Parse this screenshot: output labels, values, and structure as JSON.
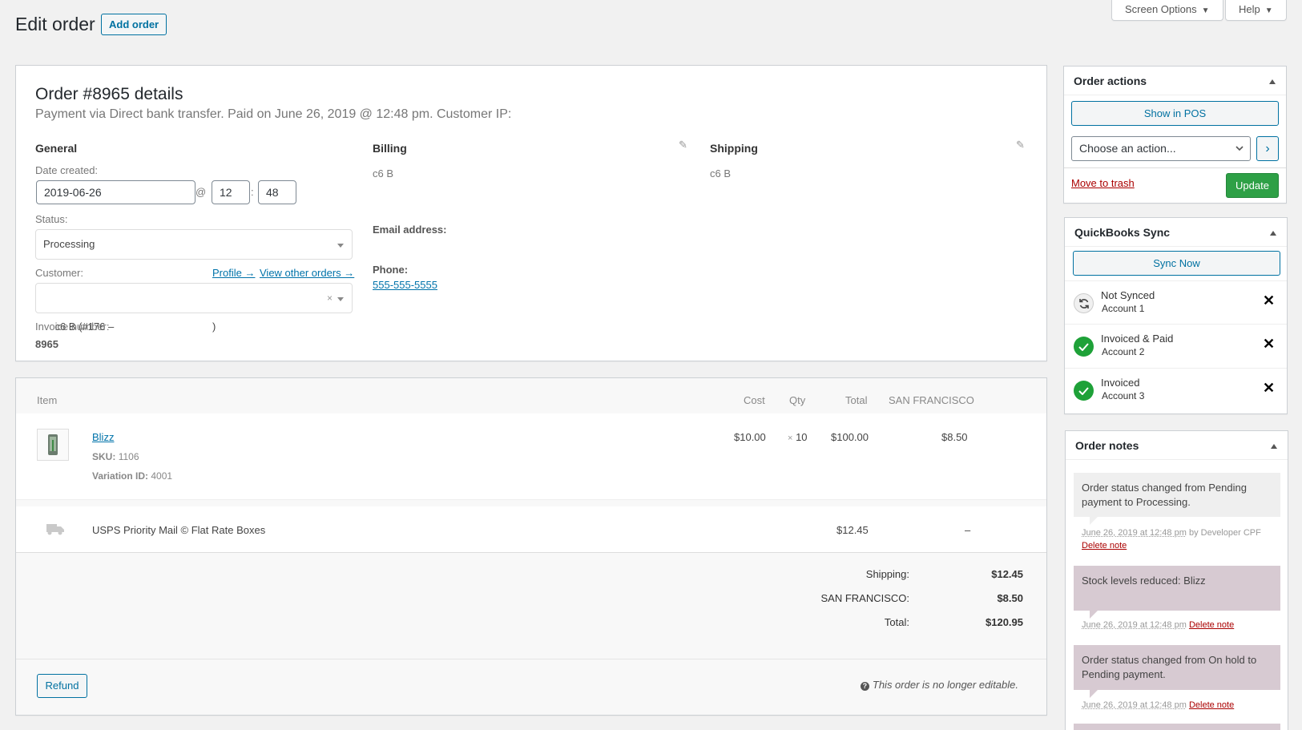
{
  "header": {
    "title": "Edit order",
    "add_button": "Add order",
    "screen_options": "Screen Options",
    "help": "Help"
  },
  "order": {
    "heading": "Order #8965 details",
    "meta": "Payment via Direct bank transfer. Paid on June 26, 2019 @ 12:48 pm. Customer IP:",
    "general": {
      "title": "General",
      "date_label": "Date created:",
      "date": "2019-06-26",
      "at": "@",
      "hour": "12",
      "colon": ":",
      "minute": "48",
      "status_label": "Status:",
      "status": "Processing",
      "customer_label": "Customer:",
      "profile_link": "Profile →",
      "other_orders_link": "View other orders →",
      "customer": "c6 B (#176 –                                  )",
      "invoice_label": "Invoice number:",
      "invoice": "8965"
    },
    "billing": {
      "title": "Billing",
      "name": "c6 B",
      "email_label": "Email address:",
      "phone_label": "Phone:",
      "phone": "555-555-5555"
    },
    "shipping": {
      "title": "Shipping",
      "name": "c6 B"
    }
  },
  "items": {
    "headers": {
      "item": "Item",
      "cost": "Cost",
      "qty": "Qty",
      "total": "Total",
      "tax": "SAN FRANCISCO"
    },
    "product": {
      "name": "Blizz",
      "sku_label": "SKU:",
      "sku": "1106",
      "variation_label": "Variation ID:",
      "variation": "4001",
      "cost": "$10.00",
      "qty_prefix": "×",
      "qty": "10",
      "total": "$100.00",
      "tax": "$8.50"
    },
    "shipping_line": {
      "name": "USPS Priority Mail © Flat Rate Boxes",
      "total": "$12.45",
      "tax": "–"
    },
    "totals": [
      {
        "label": "Shipping:",
        "value": "$12.45"
      },
      {
        "label": "SAN FRANCISCO:",
        "value": "$8.50"
      },
      {
        "label": "Total:",
        "value": "$120.95"
      }
    ],
    "refund_button": "Refund",
    "not_editable": "This order is no longer editable."
  },
  "order_actions": {
    "title": "Order actions",
    "show_pos": "Show in POS",
    "choose_action": "Choose an action...",
    "go": "›",
    "trash": "Move to trash",
    "update": "Update"
  },
  "quickbooks": {
    "title": "QuickBooks Sync",
    "sync_now": "Sync Now",
    "rows": [
      {
        "status": "Not Synced",
        "account": "Account 1",
        "icon": "sync-icon"
      },
      {
        "status": "Invoiced & Paid",
        "account": "Account 2",
        "icon": "check-icon"
      },
      {
        "status": "Invoiced",
        "account": "Account 3",
        "icon": "check-icon"
      }
    ]
  },
  "notes": {
    "title": "Order notes",
    "items": [
      {
        "text": "Order status changed from Pending payment to Processing.",
        "date": "June 26, 2019 at 12:48 pm",
        "by": "by Developer CPF",
        "delete": "Delete note"
      },
      {
        "text": "Stock levels reduced: Blizz",
        "date": "June 26, 2019 at 12:48 pm",
        "by": "",
        "delete": "Delete note"
      },
      {
        "text": "Order status changed from On hold to Pending payment.",
        "date": "June 26, 2019 at 12:48 pm",
        "by": "",
        "delete": "Delete note"
      }
    ]
  },
  "colors": {
    "accent": "#0073aa",
    "update": "#2ea046",
    "note_private": "#d7cad2",
    "note_system": "#efefef",
    "trash": "#a00"
  }
}
